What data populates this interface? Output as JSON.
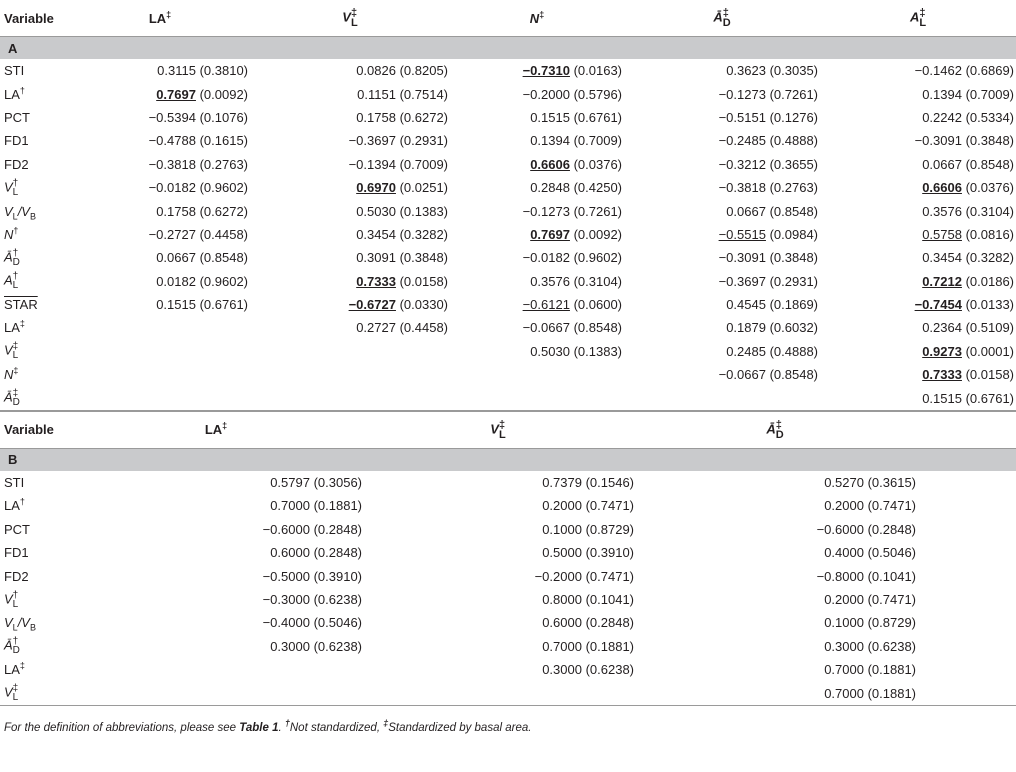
{
  "tableA": {
    "header_var": "Variable",
    "headers": [
      {
        "base": "LA",
        "sup": "‡",
        "sub": ""
      },
      {
        "base": "V",
        "sup": "‡",
        "sub": "L"
      },
      {
        "base": "N",
        "sup": "‡",
        "sub": ""
      },
      {
        "base": "Ā",
        "sup": "‡",
        "sub": "D"
      },
      {
        "base": "A",
        "sup": "‡",
        "sub": "L"
      }
    ],
    "section": "A",
    "rows": [
      {
        "label": "STI",
        "cells": [
          {
            "val": "0.3115",
            "p": "(0.3810)",
            "style": ""
          },
          {
            "val": "0.0826",
            "p": "(0.8205)",
            "style": ""
          },
          {
            "val": "−0.7310",
            "p": "(0.0163)",
            "style": "bu"
          },
          {
            "val": "0.3623",
            "p": "(0.3035)",
            "style": ""
          },
          {
            "val": "−0.1462",
            "p": "(0.6869)",
            "style": ""
          }
        ]
      },
      {
        "label": "LA",
        "sup": "†",
        "cells": [
          {
            "val": "0.7697",
            "p": "(0.0092)",
            "style": "bu"
          },
          {
            "val": "0.1151",
            "p": "(0.7514)",
            "style": ""
          },
          {
            "val": "−0.2000",
            "p": "(0.5796)",
            "style": ""
          },
          {
            "val": "−0.1273",
            "p": "(0.7261)",
            "style": ""
          },
          {
            "val": "0.1394",
            "p": "(0.7009)",
            "style": ""
          }
        ]
      },
      {
        "label": "PCT",
        "cells": [
          {
            "val": "−0.5394",
            "p": "(0.1076)",
            "style": ""
          },
          {
            "val": "0.1758",
            "p": "(0.6272)",
            "style": ""
          },
          {
            "val": "0.1515",
            "p": "(0.6761)",
            "style": ""
          },
          {
            "val": "−0.5151",
            "p": "(0.1276)",
            "style": ""
          },
          {
            "val": "0.2242",
            "p": "(0.5334)",
            "style": ""
          }
        ]
      },
      {
        "label": "FD1",
        "cells": [
          {
            "val": "−0.4788",
            "p": "(0.1615)",
            "style": ""
          },
          {
            "val": "−0.3697",
            "p": "(0.2931)",
            "style": ""
          },
          {
            "val": "0.1394",
            "p": "(0.7009)",
            "style": ""
          },
          {
            "val": "−0.2485",
            "p": "(0.4888)",
            "style": ""
          },
          {
            "val": "−0.3091",
            "p": "(0.3848)",
            "style": ""
          }
        ]
      },
      {
        "label": "FD2",
        "cells": [
          {
            "val": "−0.3818",
            "p": "(0.2763)",
            "style": ""
          },
          {
            "val": "−0.1394",
            "p": "(0.7009)",
            "style": ""
          },
          {
            "val": "0.6606",
            "p": "(0.0376)",
            "style": "bu"
          },
          {
            "val": "−0.3212",
            "p": "(0.3655)",
            "style": ""
          },
          {
            "val": "0.0667",
            "p": "(0.8548)",
            "style": ""
          }
        ]
      },
      {
        "label": "V",
        "sup": "†",
        "sub": "L",
        "cells": [
          {
            "val": "−0.0182",
            "p": "(0.9602)",
            "style": ""
          },
          {
            "val": "0.6970",
            "p": "(0.0251)",
            "style": "bu"
          },
          {
            "val": "0.2848",
            "p": "(0.4250)",
            "style": ""
          },
          {
            "val": "−0.3818",
            "p": "(0.2763)",
            "style": ""
          },
          {
            "val": "0.6606",
            "p": "(0.0376)",
            "style": "bu"
          }
        ]
      },
      {
        "label": "V",
        "sub": "L",
        "label2": "/V",
        "sub2": "B",
        "cells": [
          {
            "val": "0.1758",
            "p": "(0.6272)",
            "style": ""
          },
          {
            "val": "0.5030",
            "p": "(0.1383)",
            "style": ""
          },
          {
            "val": "−0.1273",
            "p": "(0.7261)",
            "style": ""
          },
          {
            "val": "0.0667",
            "p": "(0.8548)",
            "style": ""
          },
          {
            "val": "0.3576",
            "p": "(0.3104)",
            "style": ""
          }
        ]
      },
      {
        "label": "N",
        "sup": "†",
        "cells": [
          {
            "val": "−0.2727",
            "p": "(0.4458)",
            "style": ""
          },
          {
            "val": "0.3454",
            "p": "(0.3282)",
            "style": ""
          },
          {
            "val": "0.7697",
            "p": "(0.0092)",
            "style": "bu"
          },
          {
            "val": "−0.5515",
            "p": "(0.0984)",
            "style": "u"
          },
          {
            "val": "0.5758",
            "p": "(0.0816)",
            "style": "u"
          }
        ]
      },
      {
        "label": "Ā",
        "sup": "†",
        "sub": "D",
        "cells": [
          {
            "val": "0.0667",
            "p": "(0.8548)",
            "style": ""
          },
          {
            "val": "0.3091",
            "p": "(0.3848)",
            "style": ""
          },
          {
            "val": "−0.0182",
            "p": "(0.9602)",
            "style": ""
          },
          {
            "val": "−0.3091",
            "p": "(0.3848)",
            "style": ""
          },
          {
            "val": "0.3454",
            "p": "(0.3282)",
            "style": ""
          }
        ]
      },
      {
        "label": "A",
        "sup": "†",
        "sub": "L",
        "cells": [
          {
            "val": "0.0182",
            "p": "(0.9602)",
            "style": ""
          },
          {
            "val": "0.7333",
            "p": "(0.0158)",
            "style": "bu"
          },
          {
            "val": "0.3576",
            "p": "(0.3104)",
            "style": ""
          },
          {
            "val": "−0.3697",
            "p": "(0.2931)",
            "style": ""
          },
          {
            "val": "0.7212",
            "p": "(0.0186)",
            "style": "bu"
          }
        ]
      },
      {
        "label": "STAR",
        "overline": true,
        "cells": [
          {
            "val": "0.1515",
            "p": "(0.6761)",
            "style": ""
          },
          {
            "val": "−0.6727",
            "p": "(0.0330)",
            "style": "bu"
          },
          {
            "val": "−0.6121",
            "p": "(0.0600)",
            "style": "u"
          },
          {
            "val": "0.4545",
            "p": "(0.1869)",
            "style": ""
          },
          {
            "val": "−0.7454",
            "p": "(0.0133)",
            "style": "bu"
          }
        ]
      },
      {
        "label": "LA",
        "sup": "‡",
        "cells": [
          null,
          {
            "val": "0.2727",
            "p": "(0.4458)",
            "style": ""
          },
          {
            "val": "−0.0667",
            "p": "(0.8548)",
            "style": ""
          },
          {
            "val": "0.1879",
            "p": "(0.6032)",
            "style": ""
          },
          {
            "val": "0.2364",
            "p": "(0.5109)",
            "style": ""
          }
        ]
      },
      {
        "label": "V",
        "sup": "‡",
        "sub": "L",
        "cells": [
          null,
          null,
          {
            "val": "0.5030",
            "p": "(0.1383)",
            "style": ""
          },
          {
            "val": "0.2485",
            "p": "(0.4888)",
            "style": ""
          },
          {
            "val": "0.9273",
            "p": "(0.0001)",
            "style": "bu"
          }
        ]
      },
      {
        "label": "N",
        "sup": "‡",
        "cells": [
          null,
          null,
          null,
          {
            "val": "−0.0667",
            "p": "(0.8548)",
            "style": ""
          },
          {
            "val": "0.7333",
            "p": "(0.0158)",
            "style": "bu"
          }
        ]
      },
      {
        "label": "Ā",
        "sup": "‡",
        "sub": "D",
        "cells": [
          null,
          null,
          null,
          null,
          {
            "val": "0.1515",
            "p": "(0.6761)",
            "style": ""
          }
        ]
      }
    ]
  },
  "tableB": {
    "header_var": "Variable",
    "headers": [
      {
        "base": "LA",
        "sup": "‡",
        "sub": ""
      },
      {
        "base": "V",
        "sup": "‡",
        "sub": "L"
      },
      {
        "base": "Ā",
        "sup": "‡",
        "sub": "D"
      }
    ],
    "section": "B",
    "rows": [
      {
        "label": "STI",
        "cells": [
          {
            "val": "0.5797",
            "p": "(0.3056)",
            "style": ""
          },
          {
            "val": "0.7379",
            "p": "(0.1546)",
            "style": ""
          },
          {
            "val": "0.5270",
            "p": "(0.3615)",
            "style": ""
          }
        ]
      },
      {
        "label": "LA",
        "sup": "†",
        "cells": [
          {
            "val": "0.7000",
            "p": "(0.1881)",
            "style": ""
          },
          {
            "val": "0.2000",
            "p": "(0.7471)",
            "style": ""
          },
          {
            "val": "0.2000",
            "p": "(0.7471)",
            "style": ""
          }
        ]
      },
      {
        "label": "PCT",
        "cells": [
          {
            "val": "−0.6000",
            "p": "(0.2848)",
            "style": ""
          },
          {
            "val": "0.1000",
            "p": "(0.8729)",
            "style": ""
          },
          {
            "val": "−0.6000",
            "p": "(0.2848)",
            "style": ""
          }
        ]
      },
      {
        "label": "FD1",
        "cells": [
          {
            "val": "0.6000",
            "p": "(0.2848)",
            "style": ""
          },
          {
            "val": "0.5000",
            "p": "(0.3910)",
            "style": ""
          },
          {
            "val": "0.4000",
            "p": "(0.5046)",
            "style": ""
          }
        ]
      },
      {
        "label": "FD2",
        "cells": [
          {
            "val": "−0.5000",
            "p": "(0.3910)",
            "style": ""
          },
          {
            "val": "−0.2000",
            "p": "(0.7471)",
            "style": ""
          },
          {
            "val": "−0.8000",
            "p": "(0.1041)",
            "style": ""
          }
        ]
      },
      {
        "label": "V",
        "sup": "†",
        "sub": "L",
        "cells": [
          {
            "val": "−0.3000",
            "p": "(0.6238)",
            "style": ""
          },
          {
            "val": "0.8000",
            "p": "(0.1041)",
            "style": ""
          },
          {
            "val": "0.2000",
            "p": "(0.7471)",
            "style": ""
          }
        ]
      },
      {
        "label": "V",
        "sub": "L",
        "label2": "/V",
        "sub2": "B",
        "cells": [
          {
            "val": "−0.4000",
            "p": "(0.5046)",
            "style": ""
          },
          {
            "val": "0.6000",
            "p": "(0.2848)",
            "style": ""
          },
          {
            "val": "0.1000",
            "p": "(0.8729)",
            "style": ""
          }
        ]
      },
      {
        "label": "Ā",
        "sup": "†",
        "sub": "D",
        "cells": [
          {
            "val": "0.3000",
            "p": "(0.6238)",
            "style": ""
          },
          {
            "val": "0.7000",
            "p": "(0.1881)",
            "style": ""
          },
          {
            "val": "0.3000",
            "p": "(0.6238)",
            "style": ""
          }
        ]
      },
      {
        "label": "LA",
        "sup": "‡",
        "cells": [
          null,
          {
            "val": "0.3000",
            "p": "(0.6238)",
            "style": ""
          },
          {
            "val": "0.7000",
            "p": "(0.1881)",
            "style": ""
          }
        ]
      },
      {
        "label": "V",
        "sup": "‡",
        "sub": "L",
        "cells": [
          null,
          null,
          {
            "val": "0.7000",
            "p": "(0.1881)",
            "style": ""
          }
        ]
      }
    ]
  },
  "footnote": {
    "prefix": "For the definition of abbreviations, please see ",
    "ref": "Table 1",
    "after_ref": ". ",
    "dagger": "†",
    "text1": "Not standardized, ",
    "ddagger": "‡",
    "text2": "Standardized by basal area."
  }
}
